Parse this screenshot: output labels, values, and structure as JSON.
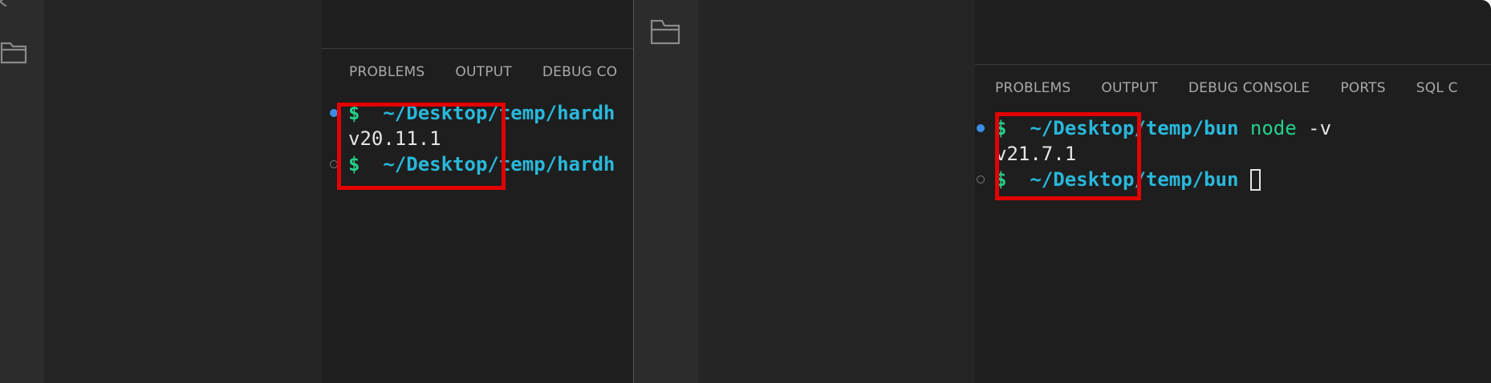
{
  "left_window": {
    "panel_tabs": [
      "PROBLEMS",
      "OUTPUT",
      "DEBUG CO"
    ],
    "terminal": {
      "line1": {
        "prompt": "$",
        "path": "~/Desktop/temp/hardh"
      },
      "line2": {
        "output": "v20.11.1"
      },
      "line3": {
        "prompt": "$",
        "path": "~/Desktop/temp/hardh"
      }
    }
  },
  "right_window": {
    "panel_tabs": [
      "PROBLEMS",
      "OUTPUT",
      "DEBUG CONSOLE",
      "PORTS",
      "SQL C"
    ],
    "terminal": {
      "line1": {
        "prompt": "$",
        "path": "~/Desktop/temp/bun",
        "command": "node",
        "arg": "-v"
      },
      "line2": {
        "output": "v21.7.1"
      },
      "line3": {
        "prompt": "$",
        "path": "~/Desktop/temp/bun"
      }
    }
  },
  "colors": {
    "highlight": "#e30000",
    "prompt_green": "#23d18b",
    "path_cyan": "#29b8db",
    "status_dot_blue": "#3a8ee6"
  },
  "icons": [
    "folder-icon",
    "chevron-left-icon"
  ]
}
